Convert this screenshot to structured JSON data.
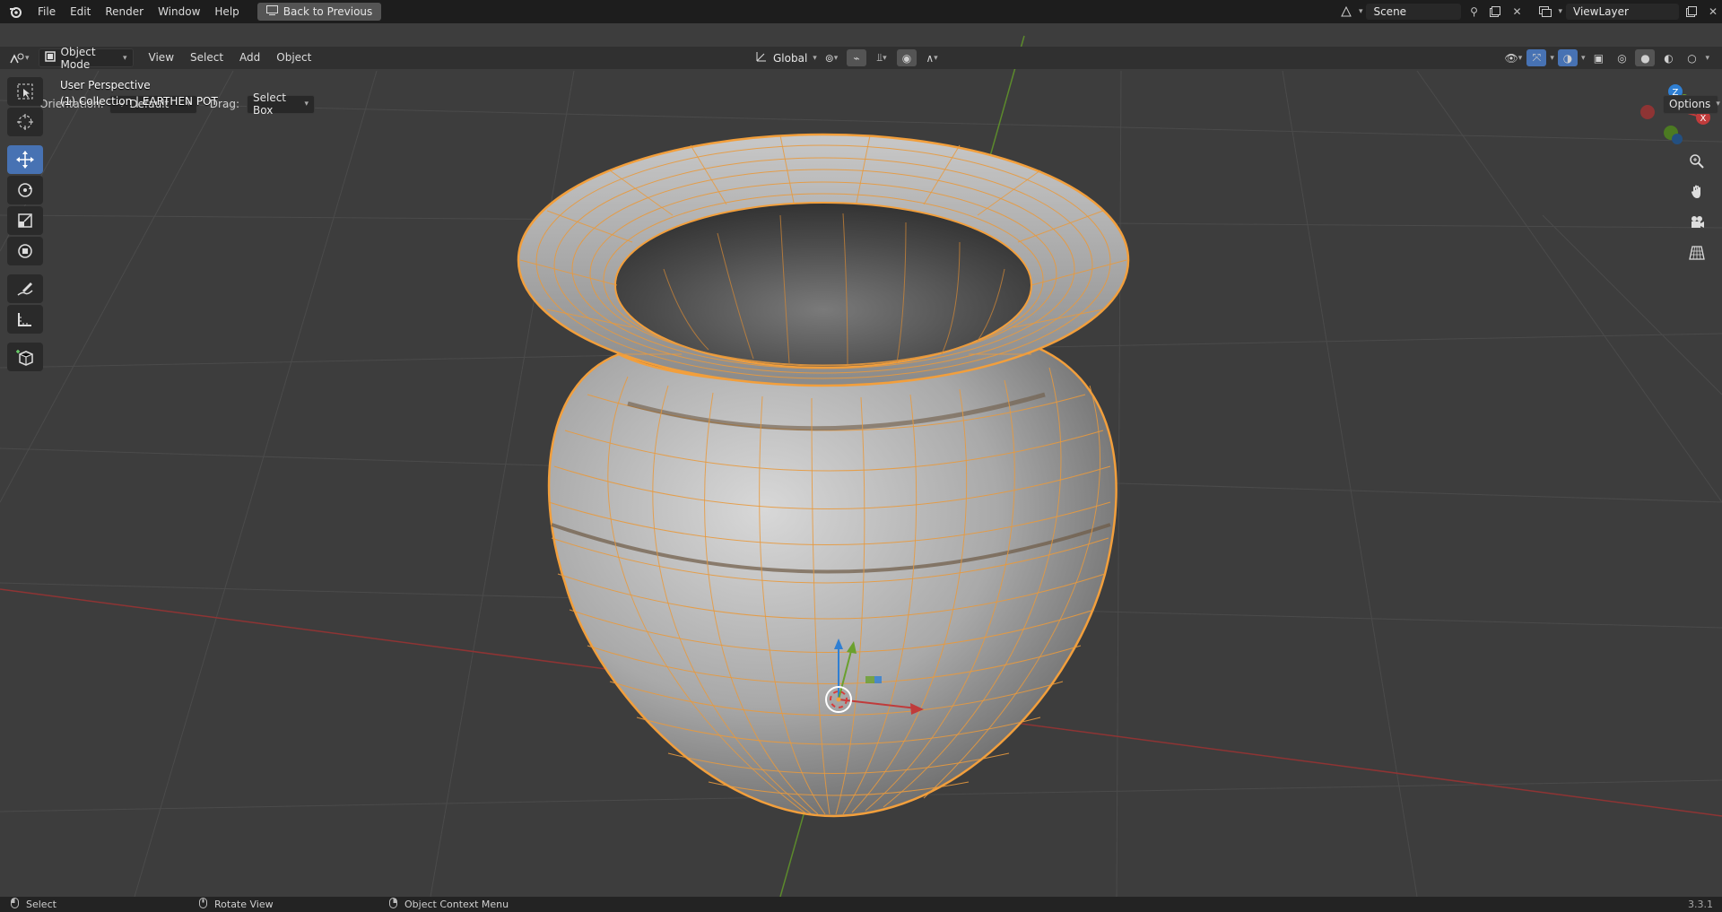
{
  "topbar": {
    "menus": [
      "File",
      "Edit",
      "Render",
      "Window",
      "Help"
    ],
    "back_label": "Back to Previous",
    "scene_name": "Scene",
    "viewlayer_name": "ViewLayer"
  },
  "header": {
    "mode": "Object Mode",
    "menus": [
      "View",
      "Select",
      "Add",
      "Object"
    ],
    "transform_orientation": "Global",
    "options_label": "Options"
  },
  "tool_settings": {
    "orientation_label": "Orientation:",
    "orientation_value": "Default",
    "drag_label": "Drag:",
    "drag_value": "Select Box"
  },
  "viewport": {
    "view_name": "User Perspective",
    "collection_info": "(1) Collection | EARTHEN POT",
    "gizmo_axes": [
      "Z",
      "X"
    ]
  },
  "colors": {
    "selection": "#f29f3c",
    "x_axis": "#b13535",
    "y_axis": "#6aa02d",
    "z_axis": "#2f7fd3",
    "active_tool": "#4772b3"
  },
  "statusbar": {
    "items": [
      "Select",
      "Rotate View",
      "Object Context Menu"
    ],
    "version": "3.3.1"
  }
}
